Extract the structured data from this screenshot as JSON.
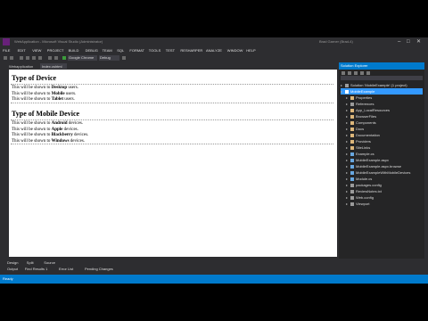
{
  "window": {
    "title": "WebApplication - Microsoft Visual Studio (Administrator)",
    "user": "Brad Garner (Brad-4)",
    "min": "–",
    "max": "□",
    "close": "✕"
  },
  "menu": [
    "FILE",
    "EDIT",
    "VIEW",
    "PROJECT",
    "BUILD",
    "DEBUG",
    "TEAM",
    "SQL",
    "FORMAT",
    "TOOLS",
    "TEST",
    "RESHARPER",
    "ANALYZE",
    "WINDOW",
    "HELP"
  ],
  "toolbar": {
    "browser": "Google Chrome",
    "config": "Debug"
  },
  "doc_tabs": {
    "file": "Webapplication",
    "view": "Index.cshtml"
  },
  "editor": {
    "heading1": "Type of Device",
    "device_lines": [
      {
        "pre": "This will be shown to ",
        "bold": "Desktop",
        "post": " users."
      },
      {
        "pre": "This will be shown to ",
        "bold": "Mobile",
        "post": " users."
      },
      {
        "pre": "This will be shown to ",
        "bold": "Tablet",
        "post": " users."
      }
    ],
    "heading2": "Type of Mobile Device",
    "mobile_lines": [
      {
        "pre": "This will be shown to ",
        "bold": "Android",
        "post": " devices."
      },
      {
        "pre": "This will be shown to ",
        "bold": "Apple",
        "post": " devices."
      },
      {
        "pre": "This will be shown to ",
        "bold": "Blackberry",
        "post": " devices."
      },
      {
        "pre": "This will be shown to ",
        "bold": "Windows",
        "post": " devices."
      }
    ]
  },
  "solution_explorer": {
    "title": "Solution Explorer",
    "items": [
      {
        "label": "Solution 'MobileExample' (1 project)",
        "depth": 0,
        "selected": false,
        "color": "#9b9b9b"
      },
      {
        "label": "MobileExample",
        "depth": 0,
        "selected": true,
        "color": "#ffffff"
      },
      {
        "label": "Properties",
        "depth": 1,
        "selected": false,
        "color": "#dcb67a"
      },
      {
        "label": "References",
        "depth": 1,
        "selected": false,
        "color": "#9b9b9b"
      },
      {
        "label": "App_LocalResources",
        "depth": 1,
        "selected": false,
        "color": "#dcb67a"
      },
      {
        "label": "BrowserFiles",
        "depth": 1,
        "selected": false,
        "color": "#dcb67a"
      },
      {
        "label": "Components",
        "depth": 1,
        "selected": false,
        "color": "#dcb67a"
      },
      {
        "label": "Docs",
        "depth": 1,
        "selected": false,
        "color": "#dcb67a"
      },
      {
        "label": "Documentation",
        "depth": 1,
        "selected": false,
        "color": "#dcb67a"
      },
      {
        "label": "Providers",
        "depth": 1,
        "selected": false,
        "color": "#dcb67a"
      },
      {
        "label": "SiteLinks",
        "depth": 1,
        "selected": false,
        "color": "#dcb67a"
      },
      {
        "label": "Example.cs",
        "depth": 1,
        "selected": false,
        "color": "#68a7e0"
      },
      {
        "label": "MobileExample.aspx",
        "depth": 1,
        "selected": false,
        "color": "#68a7e0"
      },
      {
        "label": "MobileExample.aspx.browse",
        "depth": 1,
        "selected": false,
        "color": "#68a7e0"
      },
      {
        "label": "MobileExampleWithMobileDevices",
        "depth": 1,
        "selected": false,
        "color": "#68a7e0"
      },
      {
        "label": "Module.cs",
        "depth": 1,
        "selected": false,
        "color": "#68a7e0"
      },
      {
        "label": "packages.config",
        "depth": 1,
        "selected": false,
        "color": "#9b9b9b"
      },
      {
        "label": "ReviewNotes.txt",
        "depth": 1,
        "selected": false,
        "color": "#9b9b9b"
      },
      {
        "label": "Web.config",
        "depth": 1,
        "selected": false,
        "color": "#9b9b9b"
      },
      {
        "label": "Viewport",
        "depth": 1,
        "selected": false,
        "color": "#9b9b9b"
      }
    ]
  },
  "bottom_tabs": [
    "Design",
    "Split",
    "Source"
  ],
  "output_tabs": [
    "Output",
    "Find Results 1",
    "Error List",
    "Pending Changes"
  ],
  "status": "Ready"
}
